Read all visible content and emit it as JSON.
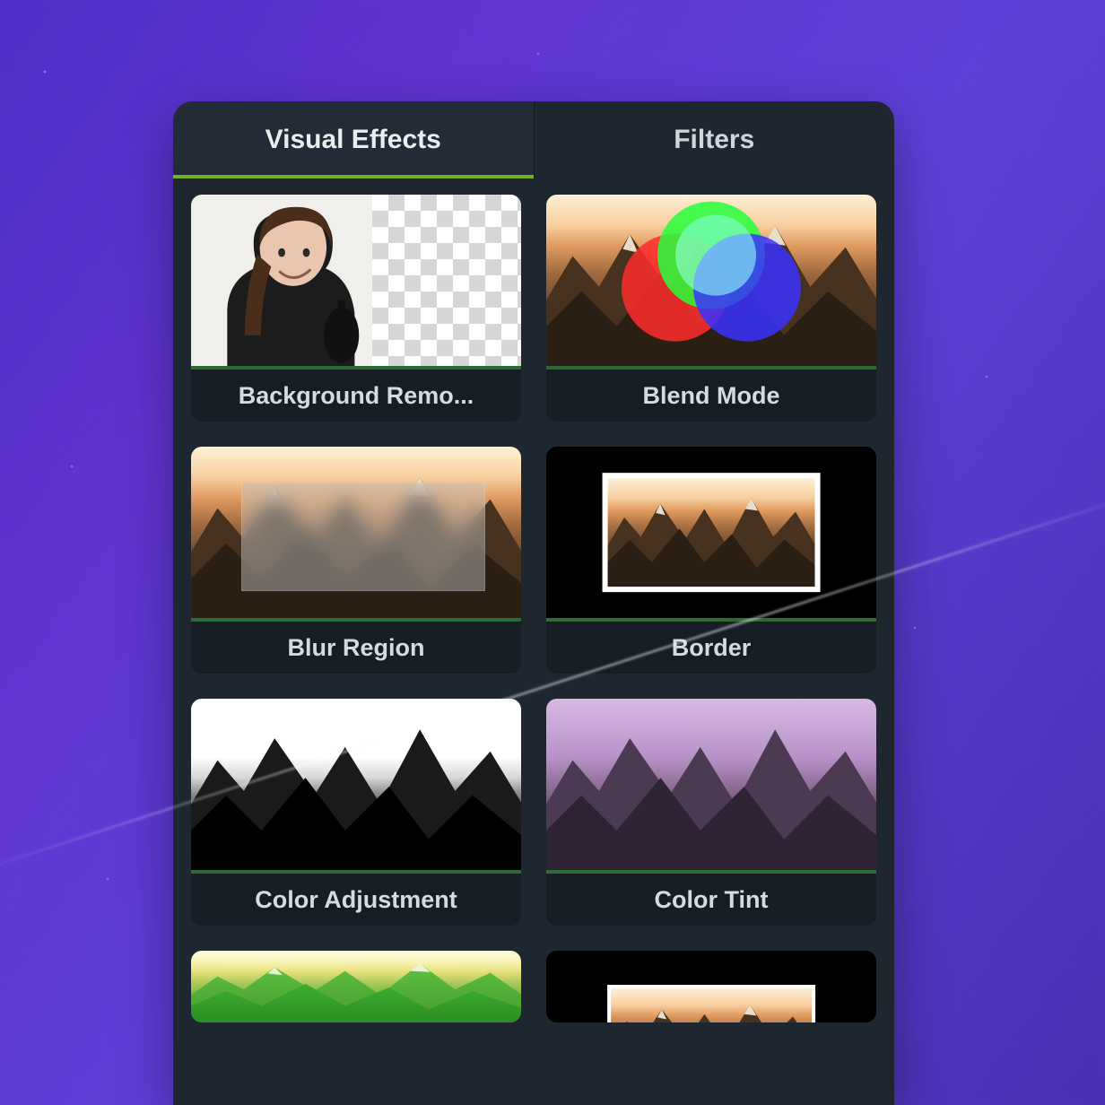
{
  "tabs": [
    {
      "label": "Visual Effects",
      "active": true
    },
    {
      "label": "Filters",
      "active": false
    }
  ],
  "effects": [
    {
      "id": "background-removal",
      "label": "Background Remo..."
    },
    {
      "id": "blend-mode",
      "label": "Blend Mode"
    },
    {
      "id": "blur-region",
      "label": "Blur Region"
    },
    {
      "id": "border",
      "label": "Border"
    },
    {
      "id": "color-adjustment",
      "label": "Color Adjustment"
    },
    {
      "id": "color-tint",
      "label": "Color Tint"
    }
  ],
  "colors": {
    "panel_bg": "#1e2630",
    "card_bg": "#161d25",
    "accent": "#6fb21e",
    "thumb_underline": "#2e6a35"
  }
}
